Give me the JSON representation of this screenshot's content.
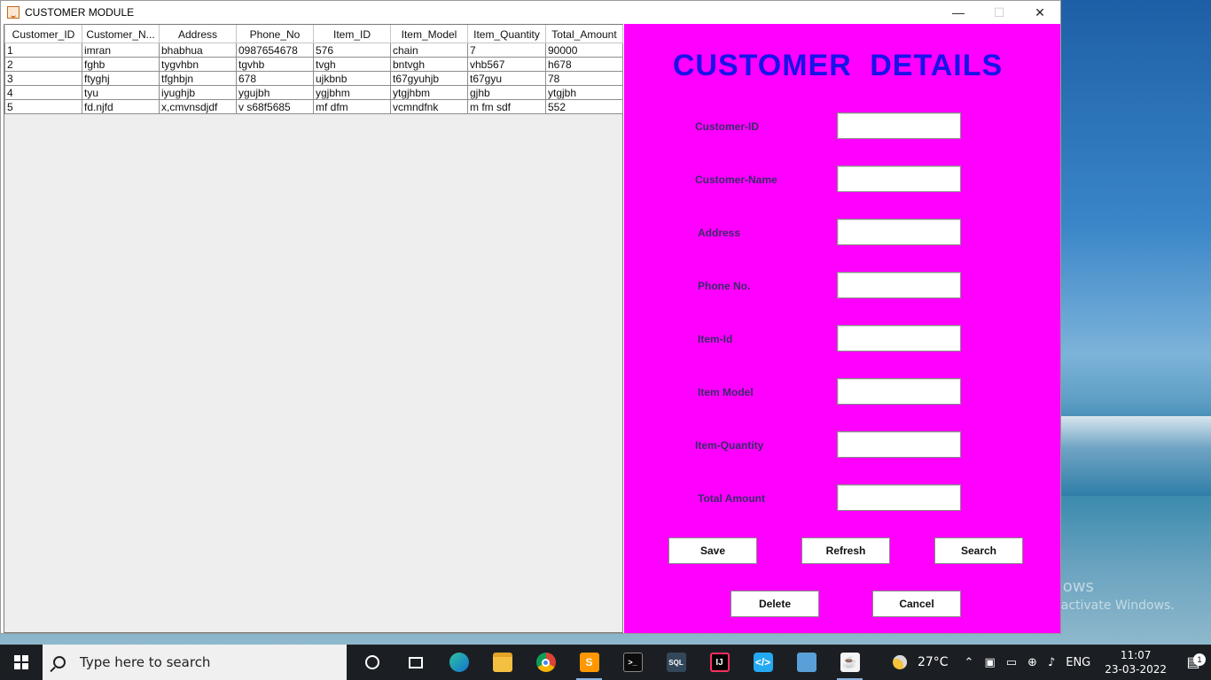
{
  "window": {
    "title": "CUSTOMER MODULE",
    "minimize": "—",
    "maximize": "☐",
    "close": "✕"
  },
  "table": {
    "columns": [
      "Customer_ID",
      "Customer_N...",
      "Address",
      "Phone_No",
      "Item_ID",
      "Item_Model",
      "Item_Quantity",
      "Total_Amount"
    ],
    "rows": [
      [
        "1",
        "imran",
        "bhabhua",
        "0987654678",
        "576",
        "chain",
        "7",
        "90000"
      ],
      [
        "2",
        "fghb",
        "tygvhbn",
        "tgvhb",
        "tvgh",
        "bntvgh",
        "vhb567",
        "h678"
      ],
      [
        "3",
        "ftyghj",
        "tfghbjn",
        "678",
        "ujkbnb",
        "t67gyuhjb",
        "t67gyu",
        "78"
      ],
      [
        "4",
        "tyu",
        "iyughjb",
        "ygujbh",
        "ygjbhm",
        "ytgjhbm",
        "gjhb",
        "ytgjbh"
      ],
      [
        "5",
        "fd.njfd",
        "x,cmvnsdjdf",
        "v s68f5685",
        "mf dfm",
        "vcmndfnk",
        "m fm sdf",
        "552"
      ]
    ]
  },
  "form": {
    "heading": "CUSTOMER  DETAILS",
    "fields": [
      {
        "label": "Customer-ID",
        "value": ""
      },
      {
        "label": "Customer-Name",
        "value": ""
      },
      {
        "label": "Address",
        "value": ""
      },
      {
        "label": "Phone No.",
        "value": ""
      },
      {
        "label": "Item-Id",
        "value": ""
      },
      {
        "label": "Item Model",
        "value": ""
      },
      {
        "label": "Item-Quantity",
        "value": ""
      },
      {
        "label": "Total Amount",
        "value": ""
      }
    ],
    "buttons": {
      "save": "Save",
      "refresh": "Refresh",
      "search": "Search",
      "delete": "Delete",
      "cancel": "Cancel"
    }
  },
  "desktop": {
    "watermark_line1": "Activate Windows",
    "watermark_line2": "Go to Settings to activate Windows."
  },
  "taskbar": {
    "search_placeholder": "Type here to search",
    "temperature": "27°C",
    "language": "ENG",
    "time": "11:07",
    "date": "23-03-2022",
    "notification_count": "1",
    "icons": [
      "cortana-icon",
      "task-view-icon",
      "edge-icon",
      "file-explorer-icon",
      "chrome-icon",
      "sublime-text-icon",
      "terminal-icon",
      "sql-icon",
      "intellij-icon",
      "vscode-icon",
      "control-panel-icon",
      "java-icon"
    ]
  }
}
